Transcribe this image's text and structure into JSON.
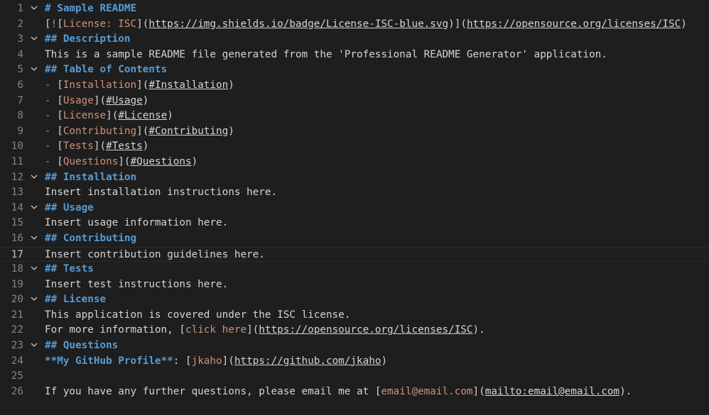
{
  "editor": {
    "current_line": "17",
    "lines": [
      {
        "num": "1",
        "fold": true,
        "s": [
          {
            "c": "h",
            "t": "# Sample README"
          }
        ]
      },
      {
        "num": "2",
        "fold": false,
        "s": [
          {
            "c": "br",
            "t": "["
          },
          {
            "c": "lt",
            "t": "!"
          },
          {
            "c": "br",
            "t": "["
          },
          {
            "c": "lt",
            "t": "License: ISC"
          },
          {
            "c": "br",
            "t": "]("
          },
          {
            "c": "url",
            "t": "https://img.shields.io/badge/License-ISC-blue.svg"
          },
          {
            "c": "br",
            "t": ")]("
          },
          {
            "c": "url",
            "t": "https://opensource.org/licenses/ISC"
          },
          {
            "c": "br",
            "t": ")"
          }
        ]
      },
      {
        "num": "3",
        "fold": true,
        "s": [
          {
            "c": "h",
            "t": "## Description"
          }
        ]
      },
      {
        "num": "4",
        "fold": false,
        "s": [
          {
            "c": "txt",
            "t": "This is a sample README file generated from the 'Professional README Generator' application."
          }
        ]
      },
      {
        "num": "5",
        "fold": true,
        "s": [
          {
            "c": "h",
            "t": "## Table of Contents"
          }
        ]
      },
      {
        "num": "6",
        "fold": false,
        "s": [
          {
            "c": "lst",
            "t": "- "
          },
          {
            "c": "br",
            "t": "["
          },
          {
            "c": "lt",
            "t": "Installation"
          },
          {
            "c": "br",
            "t": "]("
          },
          {
            "c": "url",
            "t": "#Installation"
          },
          {
            "c": "br",
            "t": ")"
          }
        ]
      },
      {
        "num": "7",
        "fold": false,
        "s": [
          {
            "c": "lst",
            "t": "- "
          },
          {
            "c": "br",
            "t": "["
          },
          {
            "c": "lt",
            "t": "Usage"
          },
          {
            "c": "br",
            "t": "]("
          },
          {
            "c": "url",
            "t": "#Usage"
          },
          {
            "c": "br",
            "t": ")"
          }
        ]
      },
      {
        "num": "8",
        "fold": false,
        "s": [
          {
            "c": "lst",
            "t": "- "
          },
          {
            "c": "br",
            "t": "["
          },
          {
            "c": "lt",
            "t": "License"
          },
          {
            "c": "br",
            "t": "]("
          },
          {
            "c": "url",
            "t": "#License"
          },
          {
            "c": "br",
            "t": ")"
          }
        ]
      },
      {
        "num": "9",
        "fold": false,
        "s": [
          {
            "c": "lst",
            "t": "- "
          },
          {
            "c": "br",
            "t": "["
          },
          {
            "c": "lt",
            "t": "Contributing"
          },
          {
            "c": "br",
            "t": "]("
          },
          {
            "c": "url",
            "t": "#Contributing"
          },
          {
            "c": "br",
            "t": ")"
          }
        ]
      },
      {
        "num": "10",
        "fold": false,
        "s": [
          {
            "c": "lst",
            "t": "- "
          },
          {
            "c": "br",
            "t": "["
          },
          {
            "c": "lt",
            "t": "Tests"
          },
          {
            "c": "br",
            "t": "]("
          },
          {
            "c": "url",
            "t": "#Tests"
          },
          {
            "c": "br",
            "t": ")"
          }
        ]
      },
      {
        "num": "11",
        "fold": false,
        "s": [
          {
            "c": "lst",
            "t": "- "
          },
          {
            "c": "br",
            "t": "["
          },
          {
            "c": "lt",
            "t": "Questions"
          },
          {
            "c": "br",
            "t": "]("
          },
          {
            "c": "url",
            "t": "#Questions"
          },
          {
            "c": "br",
            "t": ")"
          }
        ]
      },
      {
        "num": "12",
        "fold": true,
        "s": [
          {
            "c": "h",
            "t": "## Installation"
          }
        ]
      },
      {
        "num": "13",
        "fold": false,
        "s": [
          {
            "c": "txt",
            "t": "Insert installation instructions here."
          }
        ]
      },
      {
        "num": "14",
        "fold": true,
        "s": [
          {
            "c": "h",
            "t": "## Usage"
          }
        ]
      },
      {
        "num": "15",
        "fold": false,
        "s": [
          {
            "c": "txt",
            "t": "Insert usage information here."
          }
        ]
      },
      {
        "num": "16",
        "fold": true,
        "s": [
          {
            "c": "h",
            "t": "## Contributing"
          }
        ]
      },
      {
        "num": "17",
        "fold": false,
        "s": [
          {
            "c": "txt",
            "t": "Insert contribution guidelines here."
          }
        ]
      },
      {
        "num": "18",
        "fold": true,
        "s": [
          {
            "c": "h",
            "t": "## Tests"
          }
        ]
      },
      {
        "num": "19",
        "fold": false,
        "s": [
          {
            "c": "txt",
            "t": "Insert test instructions here."
          }
        ]
      },
      {
        "num": "20",
        "fold": true,
        "s": [
          {
            "c": "h",
            "t": "## License"
          }
        ]
      },
      {
        "num": "21",
        "fold": false,
        "s": [
          {
            "c": "txt",
            "t": "This application is covered under the ISC license."
          }
        ]
      },
      {
        "num": "22",
        "fold": false,
        "s": [
          {
            "c": "txt",
            "t": "For more information, "
          },
          {
            "c": "br",
            "t": "["
          },
          {
            "c": "lt",
            "t": "click here"
          },
          {
            "c": "br",
            "t": "]("
          },
          {
            "c": "url",
            "t": "https://opensource.org/licenses/ISC"
          },
          {
            "c": "br",
            "t": ")."
          }
        ]
      },
      {
        "num": "23",
        "fold": true,
        "s": [
          {
            "c": "h",
            "t": "## Questions"
          }
        ]
      },
      {
        "num": "24",
        "fold": false,
        "s": [
          {
            "c": "bold",
            "t": "**My GitHub Profile**"
          },
          {
            "c": "txt",
            "t": ": "
          },
          {
            "c": "br",
            "t": "["
          },
          {
            "c": "lt",
            "t": "jkaho"
          },
          {
            "c": "br",
            "t": "]("
          },
          {
            "c": "url",
            "t": "https://github.com/jkaho"
          },
          {
            "c": "br",
            "t": ")"
          }
        ]
      },
      {
        "num": "25",
        "fold": false,
        "s": []
      },
      {
        "num": "26",
        "fold": false,
        "s": [
          {
            "c": "txt",
            "t": "If you have any further questions, please email me at "
          },
          {
            "c": "br",
            "t": "["
          },
          {
            "c": "lt",
            "t": "email@email.com"
          },
          {
            "c": "br",
            "t": "]("
          },
          {
            "c": "url",
            "t": "mailto:email@email.com"
          },
          {
            "c": "br",
            "t": ")."
          }
        ]
      }
    ]
  }
}
